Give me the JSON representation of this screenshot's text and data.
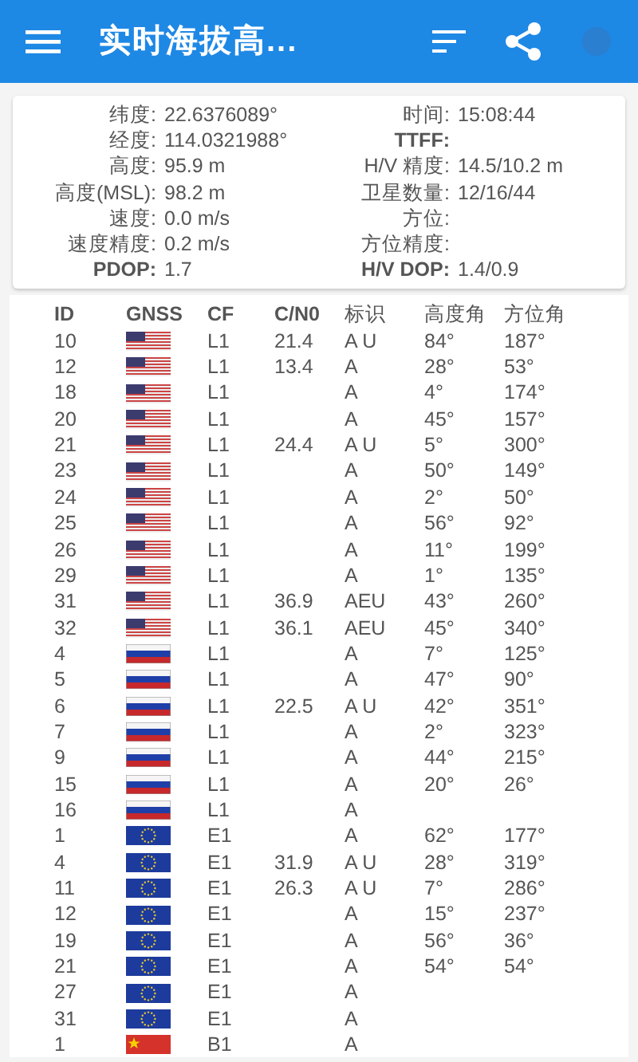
{
  "app_bar": {
    "title": "实时海拔高..."
  },
  "info": [
    {
      "label": "纬度:",
      "value": "22.6376089°"
    },
    {
      "label": "时间:",
      "value": "15:08:44"
    },
    {
      "label": "经度:",
      "value": "114.0321988°"
    },
    {
      "label": "TTFF:"
    },
    {
      "label": "高度:",
      "value": "95.9 m"
    },
    {
      "label": "H/V 精度:",
      "value": "14.5/10.2 m"
    },
    {
      "label": "高度(MSL):",
      "value": "98.2 m"
    },
    {
      "label": "卫星数量:",
      "value": "12/16/44"
    },
    {
      "label": "速度:",
      "value": "0.0 m/s"
    },
    {
      "label": "方位:"
    },
    {
      "label": "速度精度:",
      "value": "0.2 m/s"
    },
    {
      "label": "方位精度:"
    },
    {
      "label": "PDOP:",
      "value": "1.7"
    },
    {
      "label": "H/V DOP:",
      "value": "1.4/0.9"
    }
  ],
  "table": {
    "columns": [
      "ID",
      "GNSS",
      "CF",
      "C/N0",
      "标识",
      "高度角",
      "方位角"
    ],
    "rows": [
      {
        "id": "10",
        "kind": "gps",
        "cf": "L1",
        "cn0": "21.4",
        "flags": "A U",
        "elevation": "84°",
        "azimuth": "187°"
      },
      {
        "id": "12",
        "kind": "gps",
        "cf": "L1",
        "cn0": "13.4",
        "flags": "A",
        "elevation": "28°",
        "azimuth": "53°"
      },
      {
        "id": "18",
        "kind": "gps",
        "cf": "L1",
        "flags": "A",
        "elevation": "4°",
        "azimuth": "174°"
      },
      {
        "id": "20",
        "kind": "gps",
        "cf": "L1",
        "flags": "A",
        "elevation": "45°",
        "azimuth": "157°"
      },
      {
        "id": "21",
        "kind": "gps",
        "cf": "L1",
        "cn0": "24.4",
        "flags": "A U",
        "elevation": "5°",
        "azimuth": "300°"
      },
      {
        "id": "23",
        "kind": "gps",
        "cf": "L1",
        "flags": "A",
        "elevation": "50°",
        "azimuth": "149°"
      },
      {
        "id": "24",
        "kind": "gps",
        "cf": "L1",
        "flags": "A",
        "elevation": "2°",
        "azimuth": "50°"
      },
      {
        "id": "25",
        "kind": "gps",
        "cf": "L1",
        "flags": "A",
        "elevation": "56°",
        "azimuth": "92°"
      },
      {
        "id": "26",
        "kind": "gps",
        "cf": "L1",
        "flags": "A",
        "elevation": "11°",
        "azimuth": "199°"
      },
      {
        "id": "29",
        "kind": "gps",
        "cf": "L1",
        "flags": "A",
        "elevation": "1°",
        "azimuth": "135°"
      },
      {
        "id": "31",
        "kind": "gps",
        "cf": "L1",
        "cn0": "36.9",
        "flags": "AEU",
        "elevation": "43°",
        "azimuth": "260°"
      },
      {
        "id": "32",
        "kind": "gps",
        "cf": "L1",
        "cn0": "36.1",
        "flags": "AEU",
        "elevation": "45°",
        "azimuth": "340°"
      },
      {
        "id": "4",
        "kind": "glonass",
        "cf": "L1",
        "flags": "A",
        "elevation": "7°",
        "azimuth": "125°"
      },
      {
        "id": "5",
        "kind": "glonass",
        "cf": "L1",
        "flags": "A",
        "elevation": "47°",
        "azimuth": "90°"
      },
      {
        "id": "6",
        "kind": "glonass",
        "cf": "L1",
        "cn0": "22.5",
        "flags": "A U",
        "elevation": "42°",
        "azimuth": "351°"
      },
      {
        "id": "7",
        "kind": "glonass",
        "cf": "L1",
        "flags": "A",
        "elevation": "2°",
        "azimuth": "323°"
      },
      {
        "id": "9",
        "kind": "glonass",
        "cf": "L1",
        "flags": "A",
        "elevation": "44°",
        "azimuth": "215°"
      },
      {
        "id": "15",
        "kind": "glonass",
        "cf": "L1",
        "flags": "A",
        "elevation": "20°",
        "azimuth": "26°"
      },
      {
        "id": "16",
        "kind": "glonass",
        "cf": "L1",
        "flags": "A"
      },
      {
        "id": "1",
        "kind": "galileo",
        "cf": "E1",
        "flags": "A",
        "elevation": "62°",
        "azimuth": "177°"
      },
      {
        "id": "4",
        "kind": "galileo",
        "cf": "E1",
        "cn0": "31.9",
        "flags": "A U",
        "elevation": "28°",
        "azimuth": "319°"
      },
      {
        "id": "11",
        "kind": "galileo",
        "cf": "E1",
        "cn0": "26.3",
        "flags": "A U",
        "elevation": "7°",
        "azimuth": "286°"
      },
      {
        "id": "12",
        "kind": "galileo",
        "cf": "E1",
        "flags": "A",
        "elevation": "15°",
        "azimuth": "237°"
      },
      {
        "id": "19",
        "kind": "galileo",
        "cf": "E1",
        "flags": "A",
        "elevation": "56°",
        "azimuth": "36°"
      },
      {
        "id": "21",
        "kind": "galileo",
        "cf": "E1",
        "flags": "A",
        "elevation": "54°",
        "azimuth": "54°"
      },
      {
        "id": "27",
        "kind": "galileo",
        "cf": "E1",
        "flags": "A"
      },
      {
        "id": "31",
        "kind": "galileo",
        "cf": "E1",
        "flags": "A"
      },
      {
        "id": "1",
        "kind": "beidou",
        "cf": "B1",
        "flags": "A"
      }
    ]
  }
}
